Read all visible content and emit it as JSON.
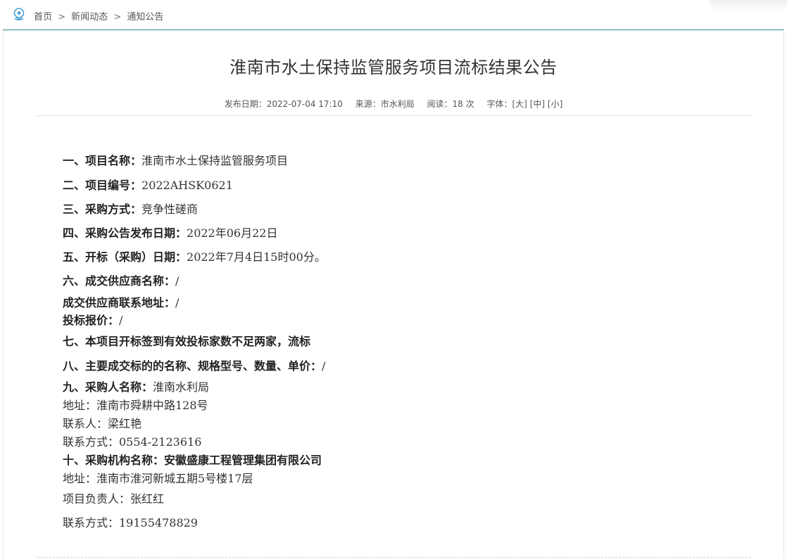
{
  "breadcrumb": {
    "items": [
      "首页",
      "新闻动态",
      "通知公告"
    ],
    "separator": ">"
  },
  "article": {
    "title": "淮南市水土保持监管服务项目流标结果公告",
    "meta": {
      "date": "发布日期：2022-07-04 17:10",
      "source": "来源：市水利局",
      "views": "阅读：18 次",
      "font_label": "字体：",
      "size_large": "[大]",
      "size_medium": "[中]",
      "size_small": "[小]"
    },
    "lines": [
      {
        "label": "一、项目名称：",
        "value": "淮南市水土保持监管服务项目"
      },
      {
        "label": "二、项目编号：",
        "value": "2022AHSK0621"
      },
      {
        "label": "三、采购方式：",
        "value": "竞争性磋商"
      },
      {
        "label": "四、采购公告发布日期：",
        "value": "2022年06月22日"
      },
      {
        "label": "五、开标（采购）日期：",
        "value": "2022年7月4日15时00分。"
      },
      {
        "label": "六、成交供应商名称：",
        "value": "/"
      },
      {
        "label": "成交供应商联系地址：",
        "value": "/"
      },
      {
        "label": "投标报价：",
        "value": "/"
      },
      {
        "label": "七、本项目开标签到有效投标家数不足两家，流标",
        "value": ""
      },
      {
        "label": "八、主要成交标的的名称、规格型号、数量、单价：",
        "value": "/"
      },
      {
        "label": "九、采购人名称：",
        "value": "淮南水利局"
      },
      {
        "label": "",
        "value": "地址：淮南市舜耕中路128号"
      },
      {
        "label": "",
        "value": "联系人：梁红艳"
      },
      {
        "label": "",
        "value": "联系方式：0554-2123616"
      },
      {
        "label": "十、采购机构名称：",
        "value": "安徽盛康工程管理集团有限公司"
      },
      {
        "label": "",
        "value": "地址：淮南市淮河新城五期5号楼17层"
      },
      {
        "label": "",
        "value": "项目负责人：张红红"
      },
      {
        "label": "",
        "value": "联系方式：19155478829"
      }
    ]
  },
  "colors": {
    "accent": "#3a8a8a",
    "icon": "#4aa0d8",
    "text": "#333333"
  },
  "icons": {
    "breadcrumb": "location-pin-icon"
  }
}
